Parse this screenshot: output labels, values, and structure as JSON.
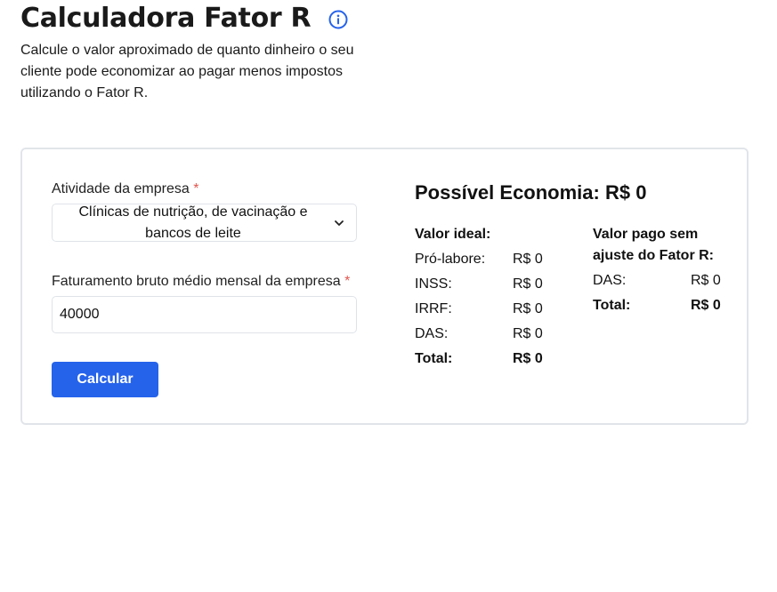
{
  "header": {
    "title": "Calculadora Fator R",
    "description": "Calcule o valor aproximado de quanto dinheiro o seu cliente pode economizar ao pagar menos impostos utilizando o Fator R."
  },
  "form": {
    "activity": {
      "label": "Atividade da empresa",
      "required_mark": "*",
      "selected": "Clínicas de nutrição, de vacinação e bancos de leite"
    },
    "revenue": {
      "label": "Faturamento bruto médio mensal da empresa",
      "required_mark": "*",
      "value": "40000"
    },
    "submit_label": "Calcular"
  },
  "results": {
    "title": "Possível Economia: R$ 0",
    "ideal": {
      "heading": "Valor ideal:",
      "rows": [
        {
          "label": "Pró-labore:",
          "value": "R$ 0"
        },
        {
          "label": "INSS:",
          "value": "R$ 0"
        },
        {
          "label": "IRRF:",
          "value": "R$ 0"
        },
        {
          "label": "DAS:",
          "value": "R$ 0"
        }
      ],
      "total_label": "Total:",
      "total_value": "R$ 0"
    },
    "without": {
      "heading": "Valor pago sem ajuste do Fator R:",
      "rows": [
        {
          "label": "DAS:",
          "value": "R$ 0"
        }
      ],
      "total_label": "Total:",
      "total_value": "R$ 0"
    }
  },
  "colors": {
    "primary": "#2563eb",
    "required": "#e0574f",
    "border": "#e1e5ea"
  },
  "icons": {
    "info": "info-circle-icon",
    "chevron": "chevron-down-icon"
  }
}
